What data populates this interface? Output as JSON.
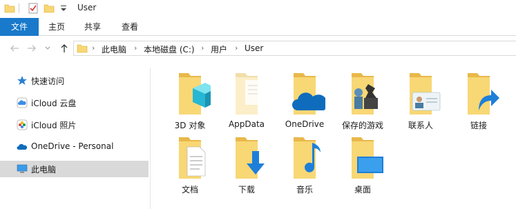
{
  "window": {
    "title": "User"
  },
  "ribbon": {
    "tabs": [
      "文件",
      "主页",
      "共享",
      "查看"
    ]
  },
  "address": {
    "crumbs": [
      "此电脑",
      "本地磁盘 (C:)",
      "用户",
      "User"
    ]
  },
  "sidebar": {
    "items": [
      {
        "label": "快速访问",
        "icon": "star-icon"
      },
      {
        "label": "iCloud 云盘",
        "icon": "icloud-drive-icon"
      },
      {
        "label": "iCloud 照片",
        "icon": "icloud-photos-icon"
      },
      {
        "label": "OneDrive - Personal",
        "icon": "onedrive-icon"
      },
      {
        "label": "此电脑",
        "icon": "computer-icon",
        "selected": true
      }
    ]
  },
  "folders": [
    {
      "label": "3D 对象",
      "overlay": "3d-cube"
    },
    {
      "label": "AppData",
      "overlay": "faded-folder"
    },
    {
      "label": "OneDrive",
      "overlay": "cloud"
    },
    {
      "label": "保存的游戏",
      "overlay": "chess-pieces"
    },
    {
      "label": "联系人",
      "overlay": "contact-card"
    },
    {
      "label": "链接",
      "overlay": "link-arrow"
    },
    {
      "label": "文档",
      "overlay": "document"
    },
    {
      "label": "下载",
      "overlay": "download-arrow"
    },
    {
      "label": "音乐",
      "overlay": "music-note"
    },
    {
      "label": "桌面",
      "overlay": "desktop"
    }
  ],
  "colors": {
    "accent": "#1979ca",
    "folder": "#f8d775",
    "selection": "#d9d9d9"
  }
}
